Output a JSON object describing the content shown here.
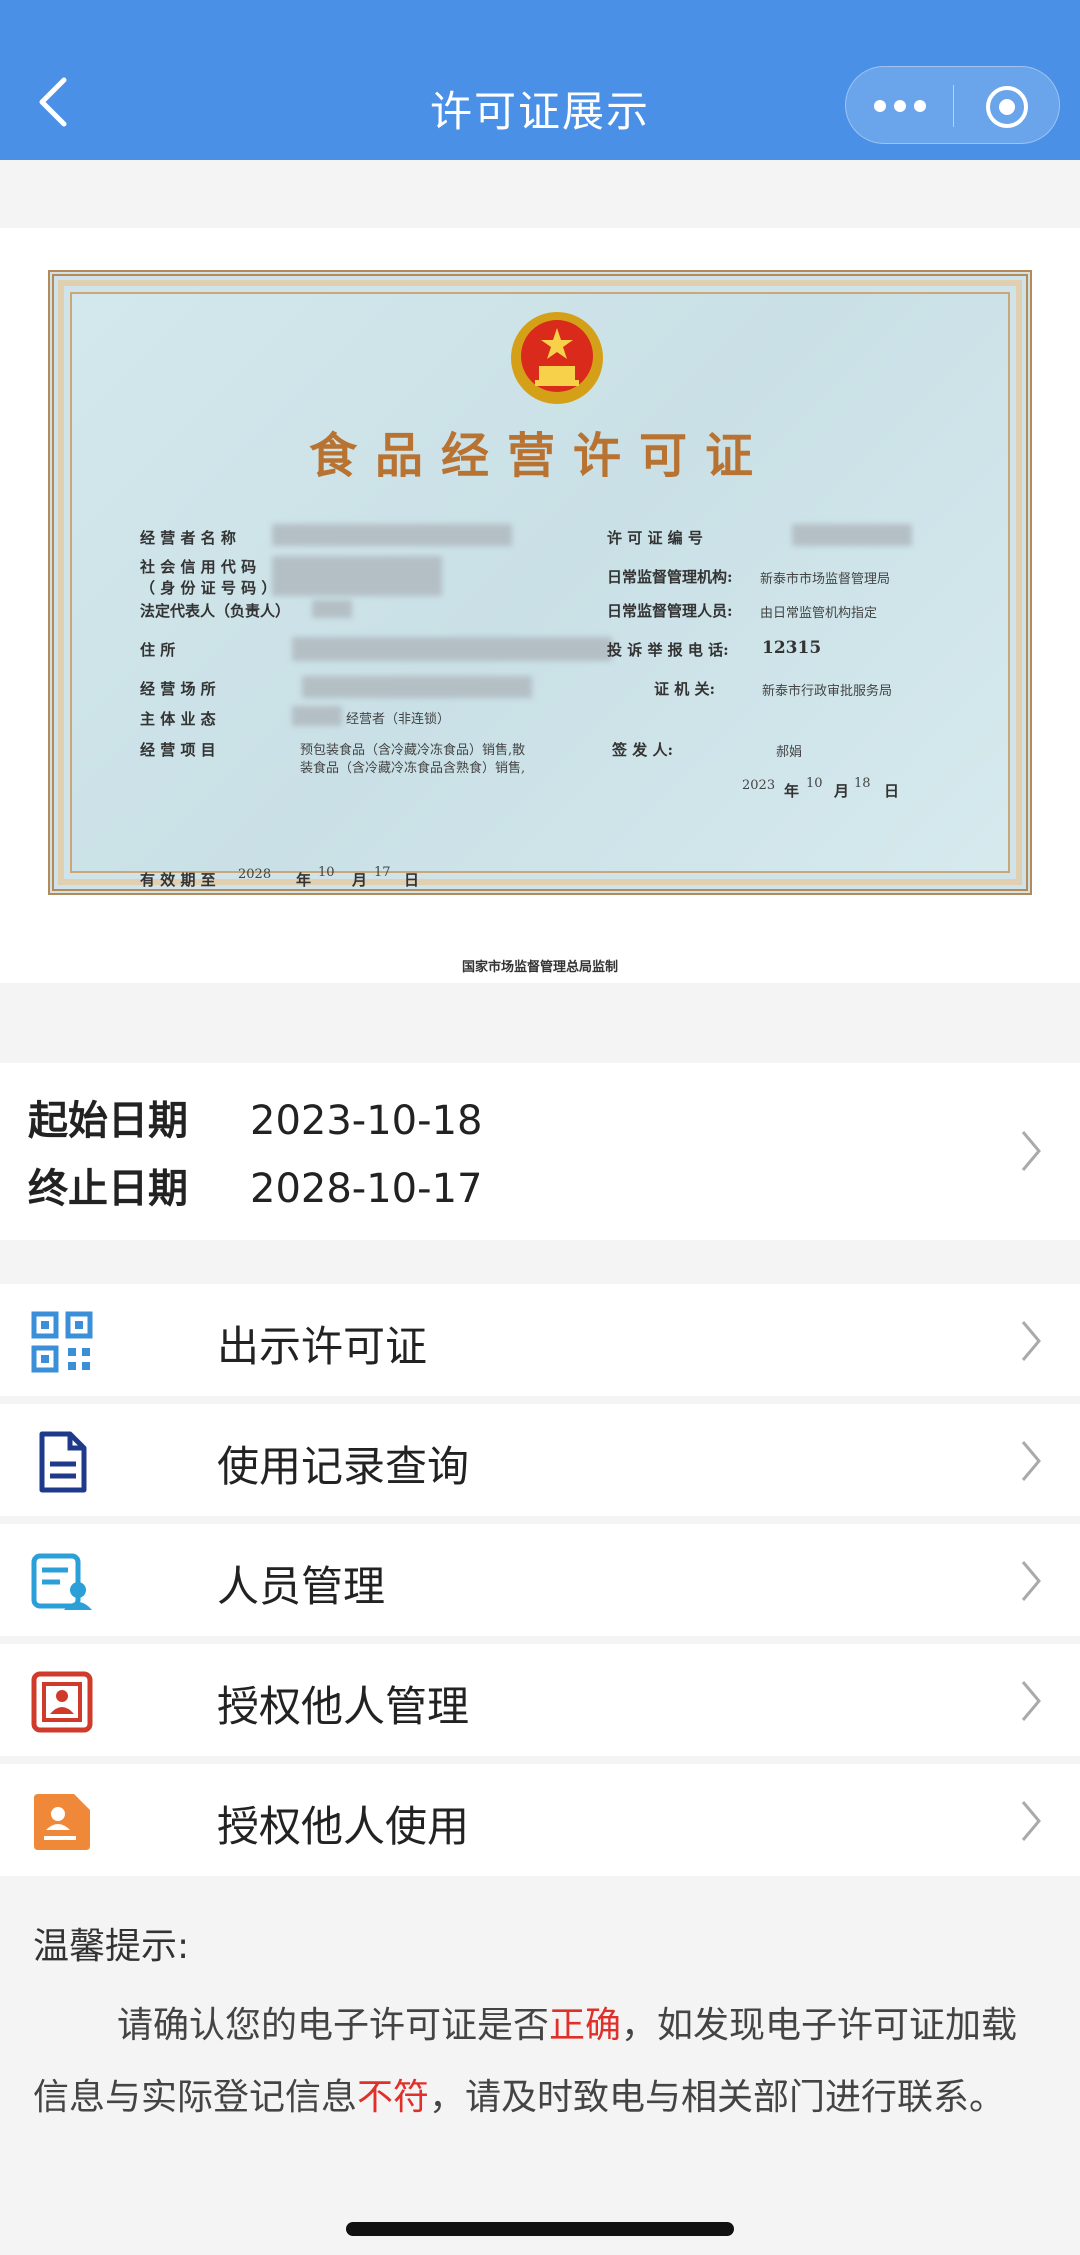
{
  "header": {
    "title": "许可证展示"
  },
  "certificate": {
    "title": "食品经营许可证",
    "fields": {
      "operator_name": "经 营 者 名 称",
      "credit_code": "社 会 信 用 代 码",
      "id_number": "（ 身 份 证 号 码 ）",
      "legal_rep": "法定代表人（负责人）",
      "residence": "住                所",
      "business_place": "经    营    场    所",
      "main_business": "主    体    业    态",
      "business_items": "经    营    项    目",
      "license_no": "许 可 证 编 号",
      "supervision_agency": "日常监督管理机构:",
      "supervision_staff": "日常监督管理人员:",
      "complaint_phone": "投 诉 举 报 电 话:",
      "issuing_authority": "证    机    关:",
      "issuer": "签    发    人:",
      "valid_until": "有 效 期 至"
    },
    "values": {
      "supervision_agency": "新泰市市场监督管理局",
      "supervision_staff": "由日常监管机构指定",
      "complaint_phone": "12315",
      "issuing_authority": "新泰市行政审批服务局",
      "issuer": "郝娟",
      "main_business": "经营者（非连锁）",
      "business_items_1": "预包装食品（含冷藏冷冻食品）销售,散",
      "business_items_2": "装食品（含冷藏冷冻食品含熟食）销售,",
      "issue_year": "2023",
      "issue_month": "10",
      "issue_day": "18",
      "valid_year": "2028",
      "valid_month": "10",
      "valid_day": "17",
      "year_unit": "年",
      "month_unit": "月",
      "day_unit": "日"
    },
    "footer": "国家市场监督管理总局监制"
  },
  "dates": {
    "start_label": "起始日期",
    "start_value": "2023-10-18",
    "end_label": "终止日期",
    "end_value": "2028-10-17"
  },
  "menu": {
    "items": [
      {
        "label": "出示许可证",
        "icon": "qr-code-icon"
      },
      {
        "label": "使用记录查询",
        "icon": "document-icon"
      },
      {
        "label": "人员管理",
        "icon": "personnel-icon"
      },
      {
        "label": "授权他人管理",
        "icon": "authorize-manage-icon"
      },
      {
        "label": "授权他人使用",
        "icon": "authorize-use-icon"
      }
    ]
  },
  "notice": {
    "title": "温馨提示:",
    "part1": "请确认您的电子许可证是否",
    "highlight1": "正确",
    "part2": "，如发现电子许可证加载信息与实际登记信息",
    "highlight2": "不符",
    "part3": "，请及时致电与相关部门进行联系。"
  },
  "colors": {
    "header_blue": "#4a90e6",
    "highlight_red": "#e0302a"
  }
}
